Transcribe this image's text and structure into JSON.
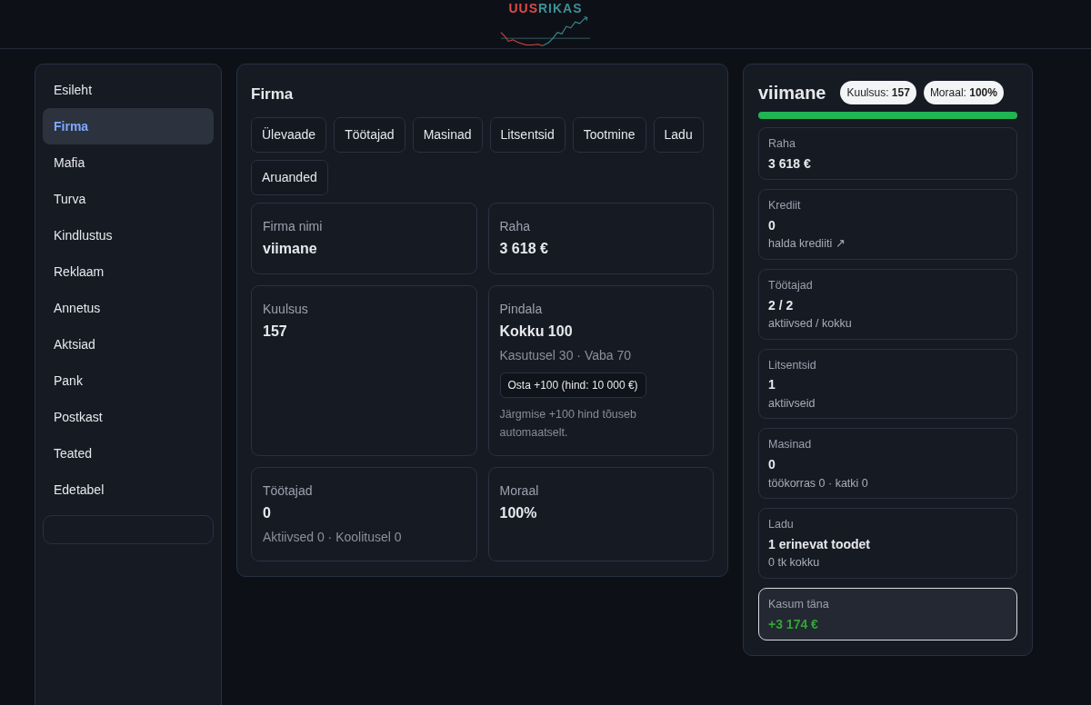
{
  "header": {
    "logo": {
      "first": "UUS",
      "second": "RIKAS"
    }
  },
  "sidebar": {
    "items": [
      {
        "label": "Esileht",
        "selected": false
      },
      {
        "label": "Firma",
        "selected": true
      },
      {
        "label": "Mafia",
        "selected": false
      },
      {
        "label": "Turva",
        "selected": false
      },
      {
        "label": "Kindlustus",
        "selected": false
      },
      {
        "label": "Reklaam",
        "selected": false
      },
      {
        "label": "Annetus",
        "selected": false
      },
      {
        "label": "Aktsiad",
        "selected": false
      },
      {
        "label": "Pank",
        "selected": false
      },
      {
        "label": "Postkast",
        "selected": false
      },
      {
        "label": "Teated",
        "selected": false
      },
      {
        "label": "Edetabel",
        "selected": false
      }
    ]
  },
  "main": {
    "title": "Firma",
    "tabs": [
      {
        "label": "Ülevaade",
        "selected": false
      },
      {
        "label": "Töötajad",
        "selected": false
      },
      {
        "label": "Masinad",
        "selected": false
      },
      {
        "label": "Litsentsid",
        "selected": false
      },
      {
        "label": "Tootmine",
        "selected": false
      },
      {
        "label": "Ladu",
        "selected": false
      },
      {
        "label": "Aruanded",
        "selected": false
      }
    ],
    "cards": [
      {
        "label": "Firma nimi",
        "value": "viimane"
      },
      {
        "label": "Raha",
        "value": "3 618 €"
      },
      {
        "label": "Kuulsus",
        "value": "157"
      },
      {
        "label": "Pindala",
        "value": "Kokku 100",
        "sub": "Kasutusel 30 · Vaba 70",
        "button": "Osta +100 (hind: 10 000 €)",
        "hint": "Järgmise +100 hind tõuseb automaatselt."
      },
      {
        "label": "Töötajad",
        "value": "0",
        "sub": "Aktiivsed 0 · Koolitusel 0"
      },
      {
        "label": "Moraal",
        "value": "100%"
      }
    ]
  },
  "summary": {
    "title": "viimane",
    "badges": [
      "Kuulsus: **157**",
      "Moraal: **100%**"
    ],
    "morale_bar": {
      "level": 1
    },
    "stats": [
      {
        "label": "Raha",
        "value": "3 618 €",
        "positive": false,
        "highlighted": false
      },
      {
        "label": "Krediit",
        "value": "0",
        "link": "halda krediiti ↗",
        "positive": false,
        "highlighted": false
      },
      {
        "label": "Töötajad",
        "value": "2 / 2",
        "sub": "aktiivsed / kokku",
        "positive": false,
        "highlighted": false
      },
      {
        "label": "Litsentsid",
        "value": "1",
        "sub": "aktiivseid",
        "positive": false,
        "highlighted": false
      },
      {
        "label": "Masinad",
        "value": "0",
        "sub": "töökorras 0 · katki 0",
        "positive": false,
        "highlighted": false
      },
      {
        "label": "Ladu",
        "value": "1 erinevat toodet",
        "sub": "0 tk kokku",
        "positive": false,
        "highlighted": false
      },
      {
        "label": "Kasum täna",
        "value": "+3 174 €",
        "positive": true,
        "highlighted": true
      }
    ]
  }
}
